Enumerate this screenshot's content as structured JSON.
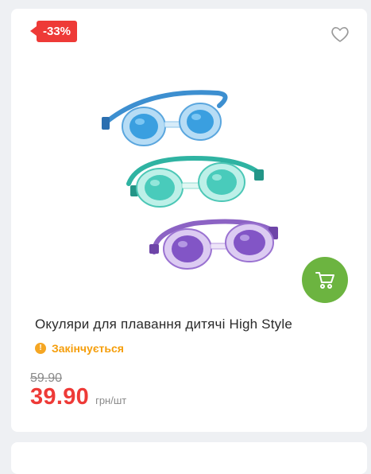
{
  "product": {
    "discount": "-33%",
    "title": "Окуляри для плавання дитячі High Style",
    "stock_status": "Закінчується",
    "old_price": "59.90",
    "price": "39.90",
    "unit": "грн/шт"
  },
  "icons": {
    "wishlist": "heart-icon",
    "cart": "cart-icon",
    "stock": "warning-icon"
  },
  "colors": {
    "discount_badge": "#ee3a37",
    "price": "#ee3a37",
    "cart_button": "#6cb440",
    "stock_status": "#f59e0b",
    "goggles": [
      "#4aa9e0",
      "#3cc4b4",
      "#8a5cc4"
    ]
  }
}
